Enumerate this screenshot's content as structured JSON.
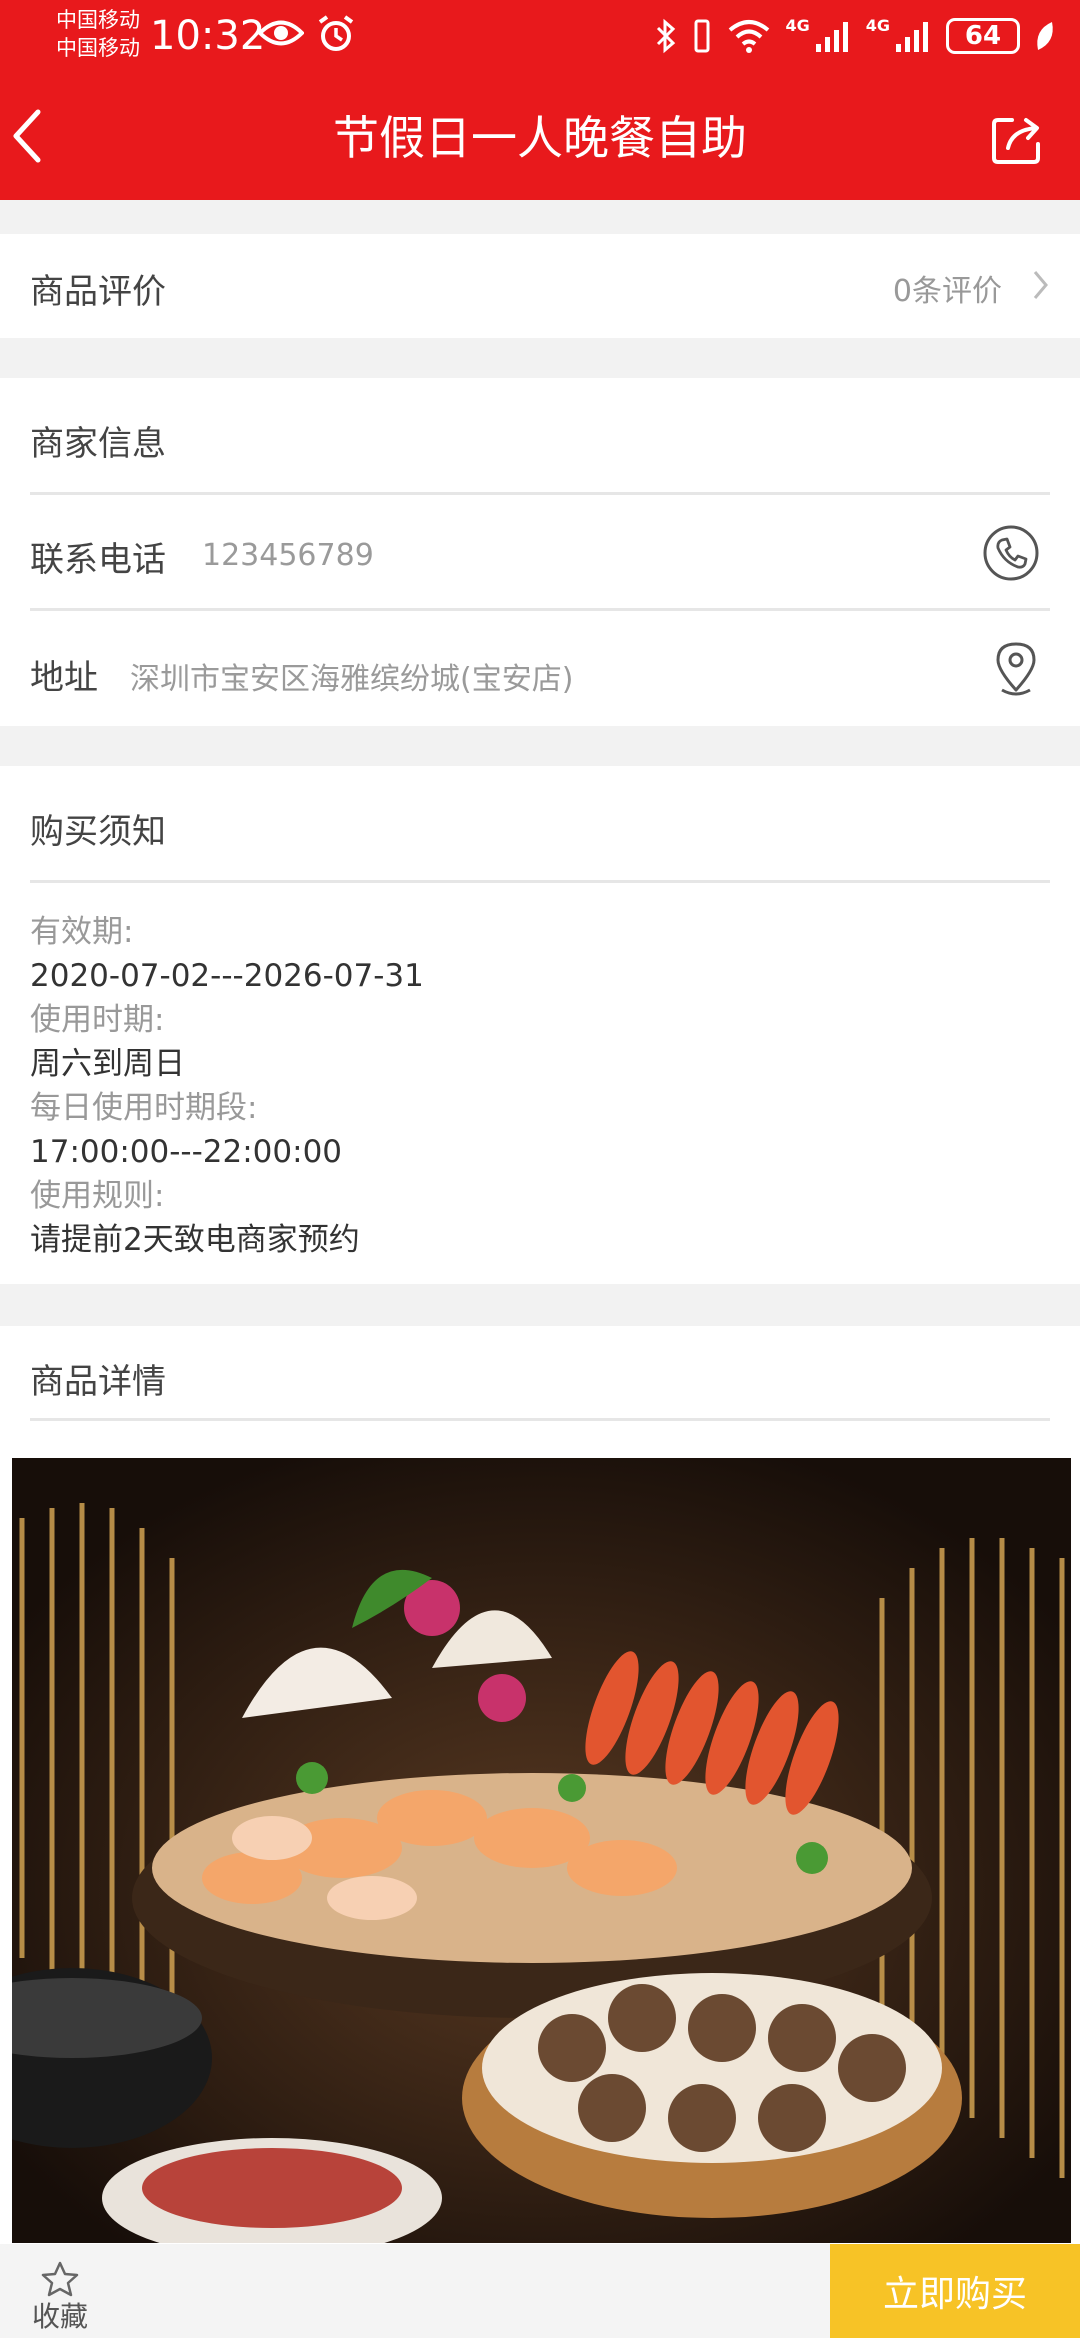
{
  "status_bar": {
    "carrier_1": "中国移动",
    "carrier_2": "中国移动",
    "time": "10:32",
    "battery": "64",
    "network_1": "4G",
    "network_2": "4G"
  },
  "header": {
    "title": "节假日一人晚餐自助",
    "bg_color": "#e8191c"
  },
  "reviews": {
    "title": "商品评价",
    "count_text": "0条评价"
  },
  "merchant": {
    "title": "商家信息",
    "phone_label": "联系电话",
    "phone_value": "123456789",
    "address_label": "地址",
    "address_value": "深圳市宝安区海雅缤纷城(宝安店)"
  },
  "purchase_notice": {
    "title": "购买须知",
    "validity_label": "有效期:",
    "validity_value": "2020-07-02---2026-07-31",
    "use_days_label": "使用时期:",
    "use_days_value": "周六到周日",
    "daily_hours_label": "每日使用时期段:",
    "daily_hours_value": "17:00:00---22:00:00",
    "rules_label": "使用规则:",
    "rules_value": "请提前2天致电商家预约"
  },
  "details": {
    "title": "商品详情"
  },
  "bottom_bar": {
    "favorite_label": "收藏",
    "buy_label": "立即购买",
    "buy_color": "#f7c326"
  },
  "icons": [
    "back-arrow-icon",
    "share-icon",
    "chevron-right-icon",
    "phone-icon",
    "location-pin-icon",
    "star-icon",
    "eye-icon",
    "alarm-icon",
    "bluetooth-icon",
    "vibrate-icon",
    "wifi-icon",
    "signal-icon",
    "battery-icon",
    "leaf-icon"
  ]
}
